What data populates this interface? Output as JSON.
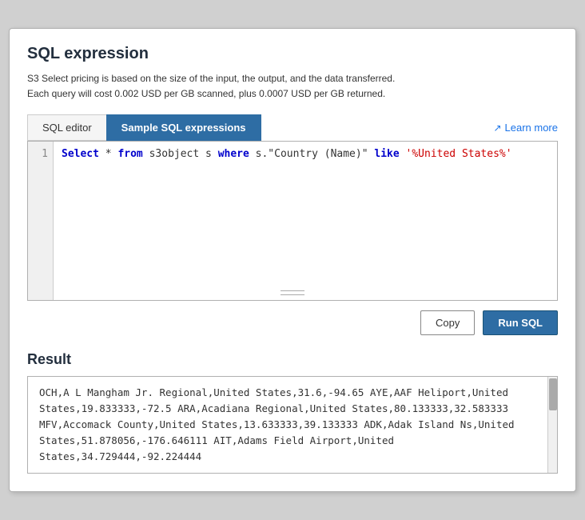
{
  "page": {
    "title": "SQL expression",
    "description_line1": "S3 Select pricing is based on the size of the input, the output, and the data transferred.",
    "description_line2": "Each query will cost 0.002 USD per GB scanned, plus 0.0007 USD per GB returned."
  },
  "tabs": {
    "editor_label": "SQL editor",
    "sample_label": "Sample SQL expressions",
    "learn_more_label": "Learn more"
  },
  "editor": {
    "line_number": "1",
    "code_parts": {
      "select": "Select",
      "star": " * ",
      "from": "from",
      "obj": " s3object s ",
      "where": "where",
      "field": " s.\"Country (Name)\" ",
      "like": "like",
      "value": " '%United States%'"
    }
  },
  "actions": {
    "copy_label": "Copy",
    "run_sql_label": "Run SQL"
  },
  "result": {
    "title": "Result",
    "rows": [
      "OCH,A L Mangham Jr. Regional,United States,31.6,-94.65",
      "AYE,AAF Heliport,United States,19.833333,-72.5",
      "ARA,Acadiana Regional,United States,80.133333,32.583333",
      "MFV,Accomack County,United States,13.633333,39.133333",
      "ADK,Adak Island Ns,United States,51.878056,-176.646111",
      "AIT,Adams Field Airport,United States,34.729444,-92.224444"
    ]
  }
}
